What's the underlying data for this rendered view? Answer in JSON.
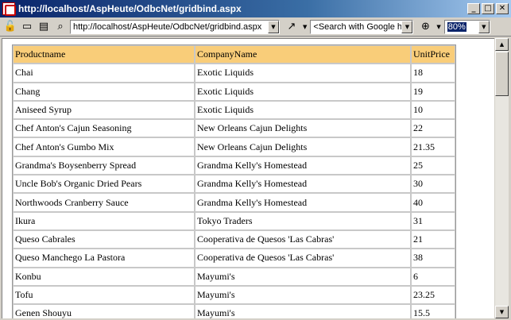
{
  "window": {
    "title": "http://localhost/AspHeute/OdbcNet/gridbind.aspx",
    "minimize": "_",
    "maximize": "□",
    "close": "✕"
  },
  "toolbar": {
    "url": "http://localhost/AspHeute/OdbcNet/gridbind.aspx",
    "search_placeholder": "<Search with Google h",
    "zoom": "80%"
  },
  "grid": {
    "columns": [
      "Productname",
      "CompanyName",
      "UnitPrice"
    ],
    "rows": [
      [
        "Chai",
        "Exotic Liquids",
        "18"
      ],
      [
        "Chang",
        "Exotic Liquids",
        "19"
      ],
      [
        "Aniseed Syrup",
        "Exotic Liquids",
        "10"
      ],
      [
        "Chef Anton's Cajun Seasoning",
        "New Orleans Cajun Delights",
        "22"
      ],
      [
        "Chef Anton's Gumbo Mix",
        "New Orleans Cajun Delights",
        "21.35"
      ],
      [
        "Grandma's Boysenberry Spread",
        "Grandma Kelly's Homestead",
        "25"
      ],
      [
        "Uncle Bob's Organic Dried Pears",
        "Grandma Kelly's Homestead",
        "30"
      ],
      [
        "Northwoods Cranberry Sauce",
        "Grandma Kelly's Homestead",
        "40"
      ],
      [
        "Ikura",
        "Tokyo Traders",
        "31"
      ],
      [
        "Queso Cabrales",
        "Cooperativa de Quesos 'Las Cabras'",
        "21"
      ],
      [
        "Queso Manchego La Pastora",
        "Cooperativa de Quesos 'Las Cabras'",
        "38"
      ],
      [
        "Konbu",
        "Mayumi's",
        "6"
      ],
      [
        "Tofu",
        "Mayumi's",
        "23.25"
      ],
      [
        "Genen Shouyu",
        "Mayumi's",
        "15.5"
      ]
    ],
    "header_color": "#f9cd79"
  }
}
